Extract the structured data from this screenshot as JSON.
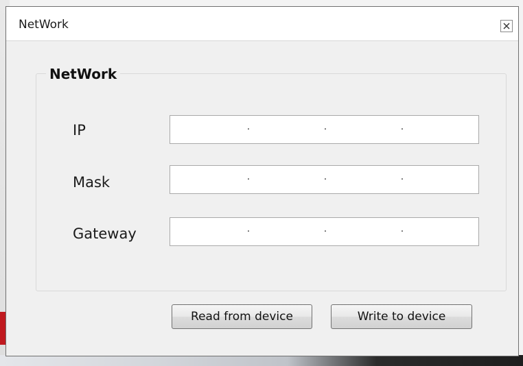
{
  "window": {
    "title": "NetWork",
    "close_icon": "close-icon"
  },
  "group": {
    "title": "NetWork"
  },
  "fields": [
    {
      "label": "IP",
      "value": ".      .      ."
    },
    {
      "label": "Mask",
      "value": ".      .      ."
    },
    {
      "label": "Gateway",
      "value": ".      .      ."
    }
  ],
  "buttons": {
    "read_label": "Read from device",
    "write_label": "Write to device"
  }
}
